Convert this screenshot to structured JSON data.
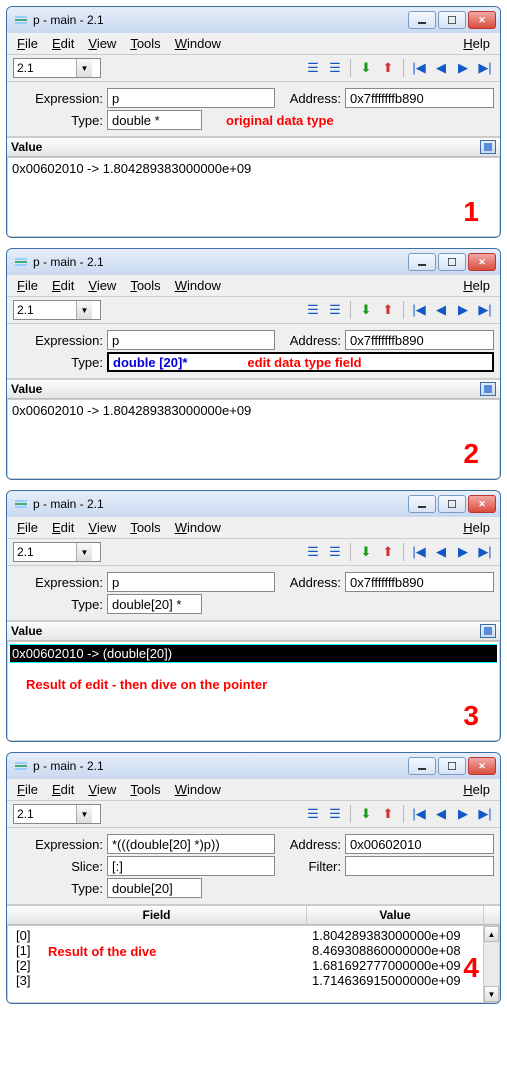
{
  "title": "p - main - 2.1",
  "menu": {
    "file": "File",
    "edit": "Edit",
    "view": "View",
    "tools": "Tools",
    "window": "Window",
    "help": "Help"
  },
  "combo_value": "2.1",
  "labels": {
    "expression": "Expression:",
    "address": "Address:",
    "type": "Type:",
    "slice": "Slice:",
    "filter": "Filter:",
    "value": "Value",
    "field": "Field"
  },
  "panels": [
    {
      "expression": "p",
      "address": "0x7fffffffb890",
      "type": "double *",
      "type_edit": false,
      "annotation_inline": "original data type",
      "value_rows": [
        "0x00602010 -> 1.804289383000000e+09"
      ],
      "selected_row": -1,
      "bottom_annotation": "",
      "number": "1"
    },
    {
      "expression": "p",
      "address": "0x7fffffffb890",
      "type": "double [20]*",
      "type_edit": true,
      "annotation_inline": "edit data type field",
      "value_rows": [
        "0x00602010 -> 1.804289383000000e+09"
      ],
      "selected_row": -1,
      "bottom_annotation": "",
      "number": "2"
    },
    {
      "expression": "p",
      "address": "0x7fffffffb890",
      "type": "double[20] *",
      "type_edit": false,
      "annotation_inline": "",
      "value_rows": [
        "0x00602010 -> (double[20])"
      ],
      "selected_row": 0,
      "bottom_annotation": "Result of edit - then dive on the pointer",
      "number": "3"
    }
  ],
  "panel4": {
    "expression": "*(((double[20] *)p))",
    "address": "0x00602010",
    "slice": "[:]",
    "filter": "",
    "type": "double[20]",
    "annotation": "Result of the dive",
    "number": "4",
    "rows": [
      {
        "field": "[0]",
        "value": "1.804289383000000e+09"
      },
      {
        "field": "[1]",
        "value": "8.469308860000000e+08"
      },
      {
        "field": "[2]",
        "value": "1.681692777000000e+09"
      },
      {
        "field": "[3]",
        "value": "1.714636915000000e+09"
      }
    ]
  }
}
